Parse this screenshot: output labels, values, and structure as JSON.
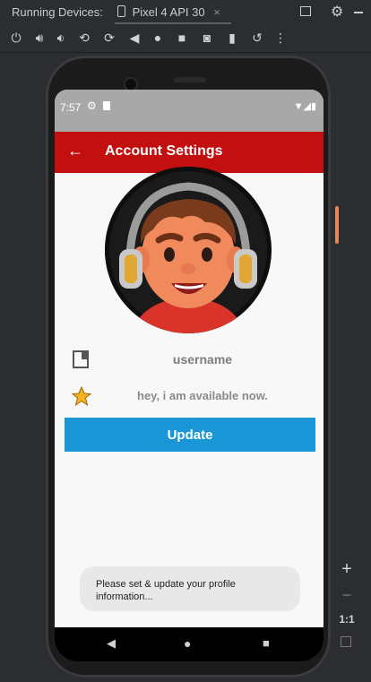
{
  "ide": {
    "panel_title": "Running Devices:",
    "device_tab": "Pixel 4 API 30",
    "tab_close": "×"
  },
  "toolbar": {
    "zoom_in": "+",
    "zoom_out": "−",
    "actual_size": "1:1"
  },
  "status_bar": {
    "time": "7:57"
  },
  "app_bar": {
    "title": "Account Settings"
  },
  "profile": {
    "username": "username",
    "about": "hey, i am available now.",
    "update_label": "Update"
  },
  "toast": {
    "message": "Please set & update your profile information..."
  },
  "colors": {
    "app_bar": "#c20f0f",
    "button": "#1a96d6"
  }
}
